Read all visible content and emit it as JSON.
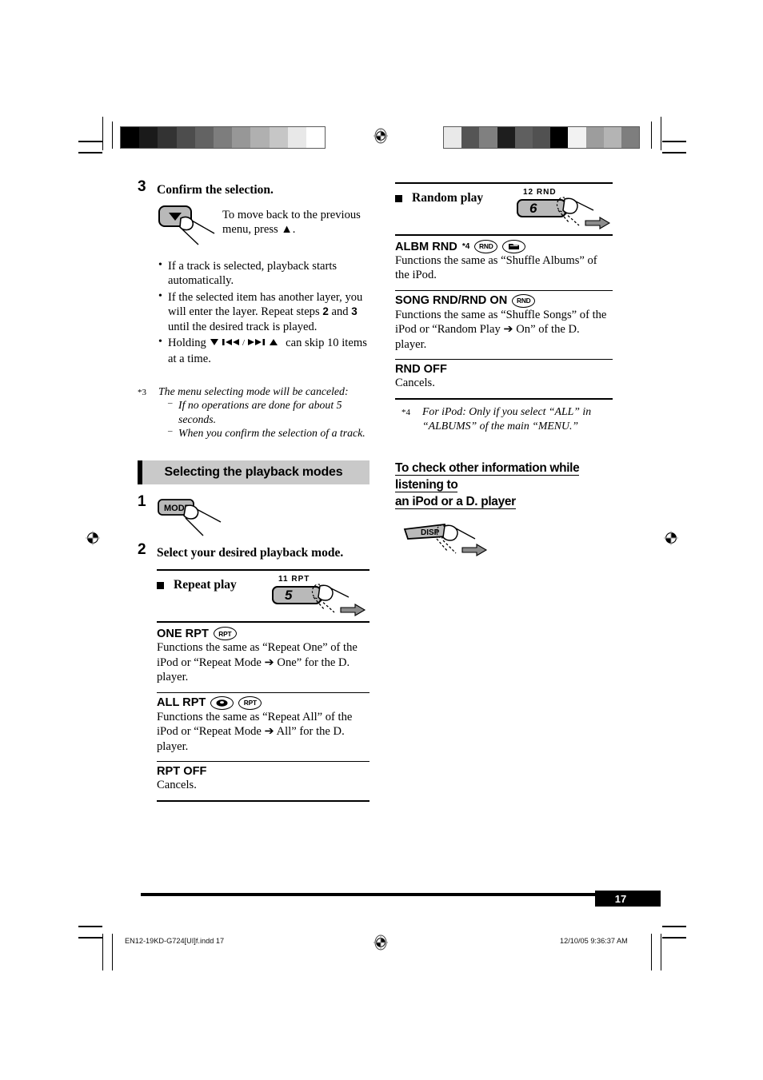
{
  "page": {
    "number": "17",
    "footer_file": "EN12-19KD-G724[UI]f.indd   17",
    "footer_timestamp": "12/10/05   9:36:37 AM"
  },
  "calibration": {
    "left_bar": [
      "#000000",
      "#1a1a1a",
      "#333333",
      "#4d4d4d",
      "#636363",
      "#7d7d7d",
      "#979797",
      "#b0b0b0",
      "#c6c6c6",
      "#e8e8e8",
      "#ffffff"
    ],
    "right_bar": [
      "#e9e9e9",
      "#555555",
      "#808080",
      "#1e1e1e",
      "#5f5f5f",
      "#515151",
      "#000000",
      "#f2f2f2",
      "#9d9d9d",
      "#b4b4b4",
      "#7e7e7e"
    ]
  },
  "left_column": {
    "step3": {
      "number": "3",
      "title": "Confirm the selection.",
      "button_caption": "To move back to the previous menu, press ▲.",
      "bullets": [
        "If a track is selected, playback starts automatically.",
        "If the selected item has another layer, you will enter the layer. Repeat steps 2 and 3 until the desired track is played.",
        "Holding ▼ |◀◀ /▶▶| ▲ can skip 10 items at a time."
      ],
      "bullet2_parts": {
        "a": "If the selected item has another layer, you will enter the layer. Repeat steps ",
        "b": "2",
        "c": " and ",
        "d": "3",
        "e": " until the desired track is played."
      },
      "bullet3_parts": {
        "a": "Holding ",
        "b": " can skip 10 items at a time."
      }
    },
    "footnote3": {
      "marker": "*3",
      "lead": "The menu selecting mode will be canceled:",
      "items": [
        "If no operations are done for about 5 seconds.",
        "When you confirm the selection of a track."
      ]
    },
    "section": {
      "title": "Selecting the playback modes",
      "step1": {
        "number": "1",
        "key_label": "MODE"
      },
      "step2": {
        "number": "2",
        "title": "Select your desired playback mode."
      }
    },
    "repeat": {
      "heading": "Repeat play",
      "display": {
        "indicator": "11  RPT",
        "number": "5"
      },
      "modes": [
        {
          "name": "ONE RPT",
          "badges": [
            "RPT"
          ],
          "desc": "Functions the same as “Repeat One” of the iPod or “Repeat Mode ➔ One” for the D. player."
        },
        {
          "name": "ALL RPT",
          "badges": [
            "disc",
            "RPT"
          ],
          "desc": "Functions the same as “Repeat All” of the iPod or “Repeat Mode ➔ All” for the D. player."
        },
        {
          "name": "RPT OFF",
          "badges": [],
          "desc": "Cancels."
        }
      ]
    }
  },
  "right_column": {
    "random": {
      "heading": "Random play",
      "display": {
        "indicator": "12  RND",
        "number": "6"
      },
      "modes": [
        {
          "name": "ALBM RND",
          "sup": "*4",
          "badges": [
            "RND",
            "folder"
          ],
          "desc": "Functions the same as “Shuffle Albums” of the iPod."
        },
        {
          "name": "SONG RND/RND ON",
          "sup": "",
          "badges": [
            "RND"
          ],
          "desc": "Functions the same as “Shuffle Songs” of the iPod or “Random Play ➔ On” of the D. player."
        },
        {
          "name": "RND OFF",
          "sup": "",
          "badges": [],
          "desc": "Cancels."
        }
      ]
    },
    "footnote4": {
      "marker": "*4",
      "text": "For iPod: Only if you select “ALL” in “ALBUMS” of the main “MENU.”"
    },
    "check_info": {
      "line1": "To check other information while listening to",
      "line2": "an iPod or a D. player",
      "key_label": "DISP"
    }
  }
}
